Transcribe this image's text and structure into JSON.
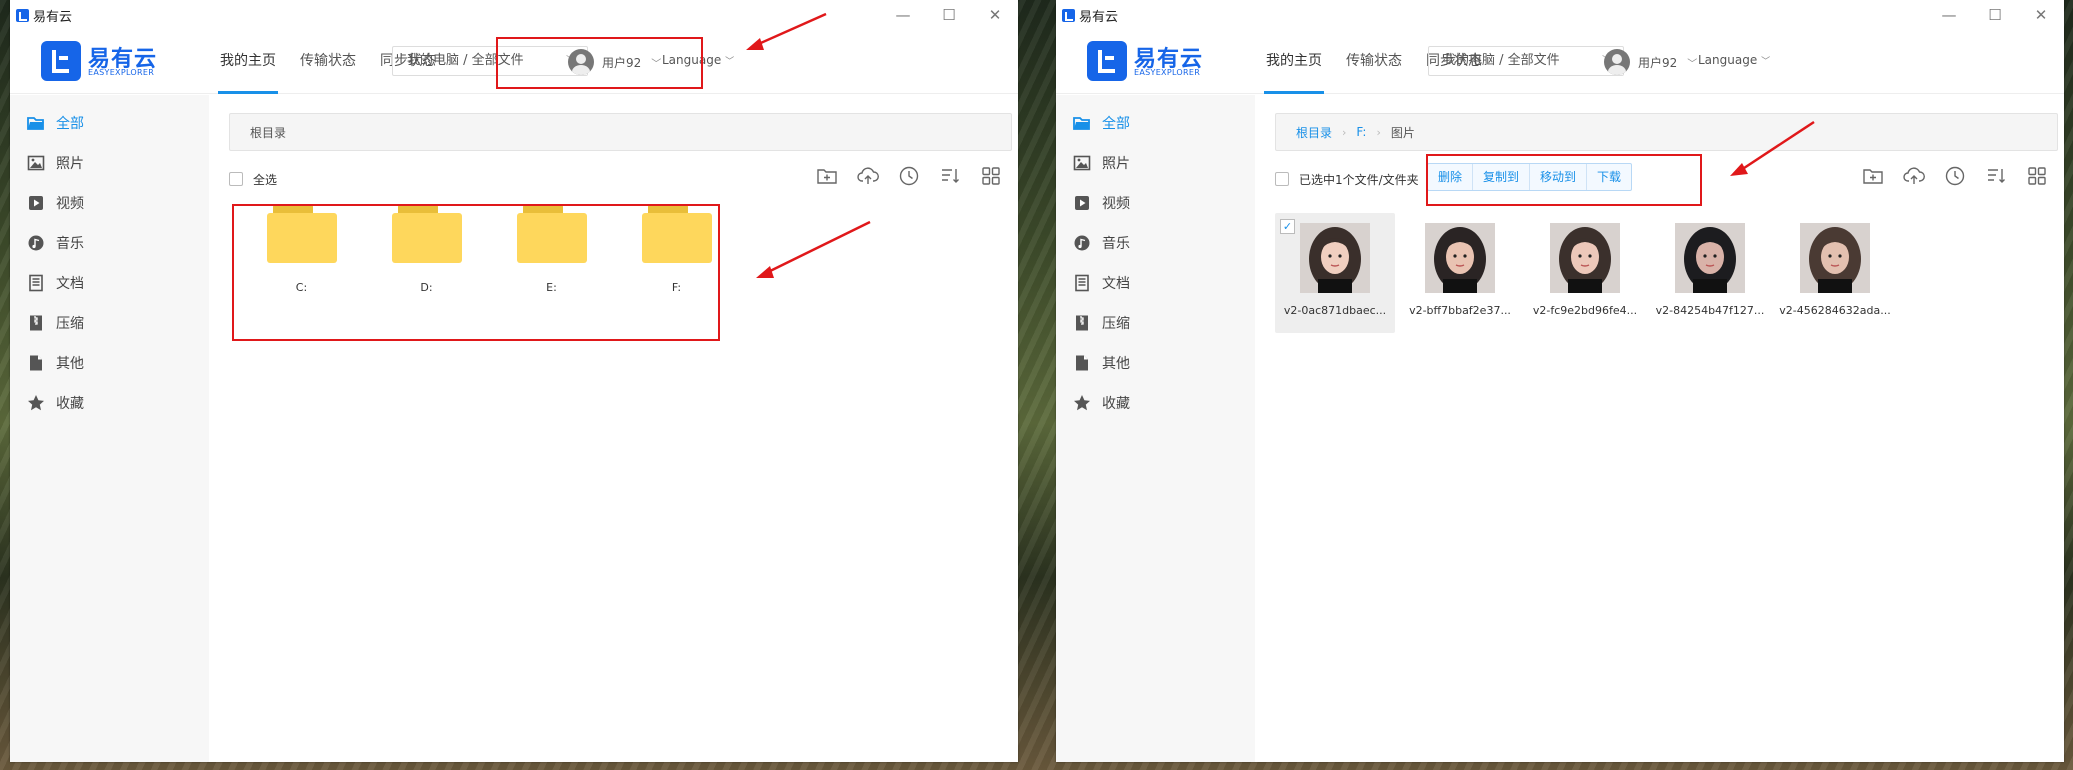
{
  "window": {
    "title": "易有云",
    "controls": [
      "—",
      "☐",
      "✕"
    ]
  },
  "brand": {
    "name": "易有云",
    "sub": "EASYEXPLORER"
  },
  "nav": [
    "我的主页",
    "传输状态",
    "同步状态"
  ],
  "path_select": "我的电脑 / 全部文件",
  "user": {
    "name": "用户92"
  },
  "language": "Language",
  "sidebar": [
    {
      "label": "全部",
      "icon": "folder-open-icon",
      "active": true
    },
    {
      "label": "照片",
      "icon": "image-icon"
    },
    {
      "label": "视频",
      "icon": "video-icon"
    },
    {
      "label": "音乐",
      "icon": "music-icon"
    },
    {
      "label": "文档",
      "icon": "document-icon"
    },
    {
      "label": "压缩",
      "icon": "zip-icon"
    },
    {
      "label": "其他",
      "icon": "file-icon"
    },
    {
      "label": "收藏",
      "icon": "star-icon"
    }
  ],
  "left": {
    "breadcrumb": "根目录",
    "select_all": "全选",
    "folders": [
      "C:",
      "D:",
      "E:",
      "F:"
    ]
  },
  "right": {
    "breadcrumb": [
      "根目录",
      "F:",
      "图片"
    ],
    "selection_text": "已选中1个文件/文件夹",
    "actions": [
      "删除",
      "复制到",
      "移动到",
      "下载"
    ],
    "photos": [
      {
        "name": "v2-0ac871dbaec...",
        "selected": true
      },
      {
        "name": "v2-bff7bbaf2e37...",
        "selected": false
      },
      {
        "name": "v2-fc9e2bd96fe4...",
        "selected": false
      },
      {
        "name": "v2-84254b47f127...",
        "selected": false
      },
      {
        "name": "v2-456284632ada...",
        "selected": false
      }
    ]
  },
  "toolbar_icons": [
    "new-folder-icon",
    "upload-icon",
    "history-icon",
    "sort-icon",
    "grid-view-icon"
  ],
  "colors": {
    "accent": "#1890e8",
    "brand": "#1665e8",
    "folder": "#fed75c",
    "annotation": "#e0181a"
  }
}
